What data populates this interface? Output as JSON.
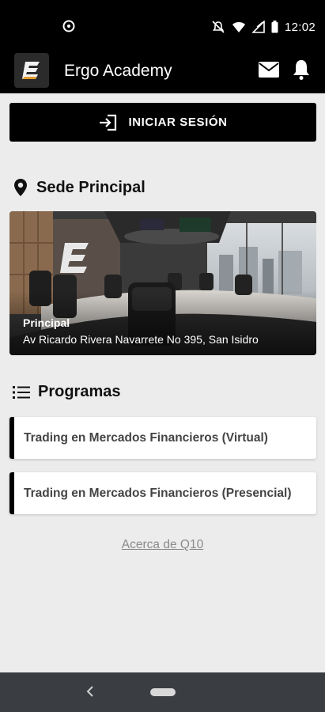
{
  "status_bar": {
    "time": "12:02",
    "icons": [
      "data-saver-icon",
      "mute-icon",
      "wifi-icon",
      "signal-icon",
      "battery-icon"
    ]
  },
  "app_bar": {
    "title": "Ergo Academy",
    "logo_letter": "E",
    "icons": [
      "mail-icon",
      "bell-icon"
    ]
  },
  "login": {
    "label": "INICIAR SESIÓN",
    "icon": "login-icon"
  },
  "campus_section": {
    "title": "Sede Principal",
    "icon": "location-pin-icon",
    "card": {
      "name": "Principal",
      "address": "Av Ricardo Rivera Navarrete No 395, San Isidro"
    }
  },
  "programs_section": {
    "title": "Programas",
    "icon": "list-icon",
    "items": [
      {
        "label": "Trading en Mercados Financieros (Virtual)"
      },
      {
        "label": "Trading en Mercados Financieros (Presencial)"
      }
    ]
  },
  "about_link": "Acerca de Q10",
  "colors": {
    "app_bar": "#000000",
    "background": "#ececec",
    "accent": "#000000",
    "nav_bar": "#3a3d42"
  }
}
